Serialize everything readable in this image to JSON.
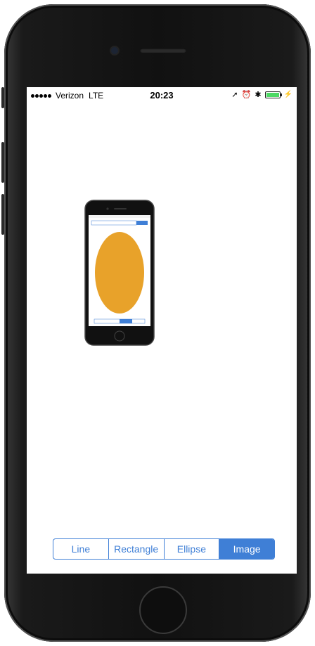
{
  "status_bar": {
    "carrier": "Verizon",
    "network": "LTE",
    "time": "20:23",
    "icons": [
      "location-icon",
      "alarm-icon",
      "bluetooth-icon",
      "battery-icon",
      "charging-icon"
    ],
    "battery_color": "#4cd964"
  },
  "canvas": {
    "content": "image-of-phone-with-ellipse",
    "ellipse_color": "#e8a22a"
  },
  "segmented_control": {
    "segments": [
      {
        "label": "Line",
        "selected": false
      },
      {
        "label": "Rectangle",
        "selected": false
      },
      {
        "label": "Ellipse",
        "selected": false
      },
      {
        "label": "Image",
        "selected": true
      }
    ],
    "accent_color": "#3f7fd6"
  }
}
